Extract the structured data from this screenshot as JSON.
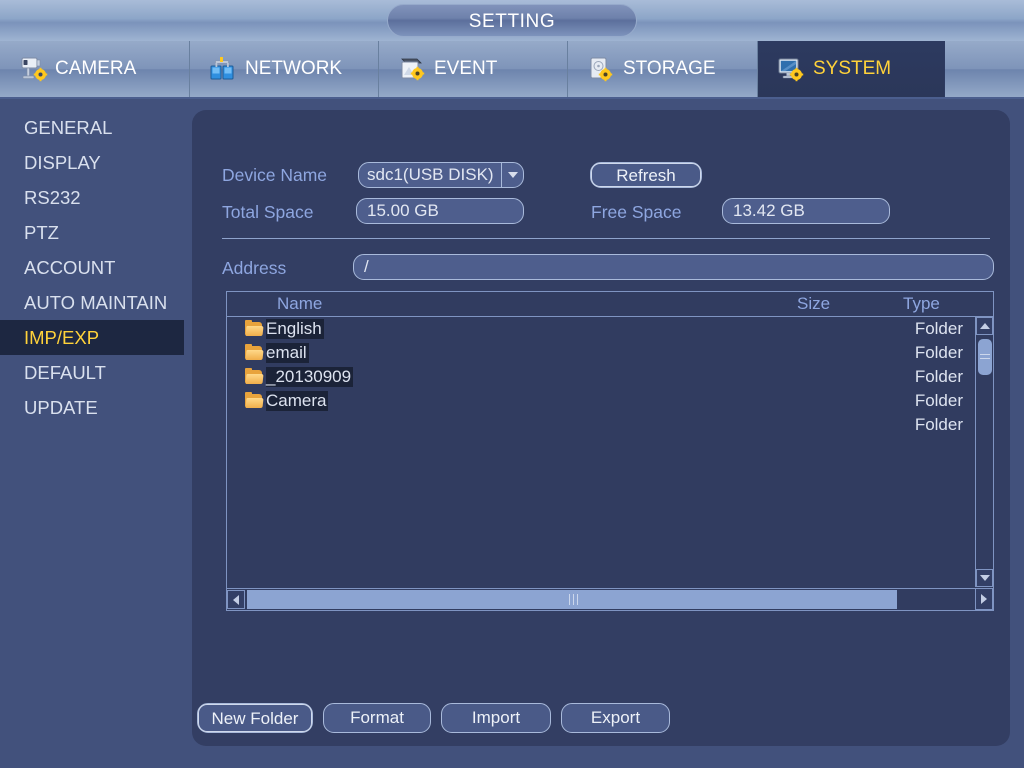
{
  "window": {
    "title": "SETTING"
  },
  "tabs": [
    {
      "label": "CAMERA",
      "icon": "camera-gear-icon",
      "active": false
    },
    {
      "label": "NETWORK",
      "icon": "network-icon",
      "active": false
    },
    {
      "label": "EVENT",
      "icon": "event-gear-icon",
      "active": false
    },
    {
      "label": "STORAGE",
      "icon": "storage-gear-icon",
      "active": false
    },
    {
      "label": "SYSTEM",
      "icon": "monitor-gear-icon",
      "active": true
    }
  ],
  "sidebar": {
    "items": [
      {
        "label": "GENERAL",
        "selected": false
      },
      {
        "label": "DISPLAY",
        "selected": false
      },
      {
        "label": "RS232",
        "selected": false
      },
      {
        "label": "PTZ",
        "selected": false
      },
      {
        "label": "ACCOUNT",
        "selected": false
      },
      {
        "label": "AUTO MAINTAIN",
        "selected": false
      },
      {
        "label": "IMP/EXP",
        "selected": true
      },
      {
        "label": "DEFAULT",
        "selected": false
      },
      {
        "label": "UPDATE",
        "selected": false
      }
    ]
  },
  "form": {
    "device_name_label": "Device Name",
    "device_name_value": "sdc1(USB DISK)",
    "refresh_label": "Refresh",
    "total_space_label": "Total Space",
    "total_space_value": "15.00 GB",
    "free_space_label": "Free Space",
    "free_space_value": "13.42 GB",
    "address_label": "Address",
    "address_value": "/"
  },
  "filelist": {
    "columns": {
      "name": "Name",
      "size": "Size",
      "type": "Type"
    },
    "rows": [
      {
        "name": "English",
        "size": "",
        "type": "Folder"
      },
      {
        "name": "email",
        "size": "",
        "type": "Folder"
      },
      {
        "name": "_20130909",
        "size": "",
        "type": "Folder"
      },
      {
        "name": "Camera",
        "size": "",
        "type": "Folder"
      },
      {
        "name": "",
        "size": "",
        "type": "Folder"
      }
    ]
  },
  "actions": {
    "new_folder": "New Folder",
    "format": "Format",
    "import": "Import",
    "export": "Export"
  },
  "colors": {
    "page_background": "#42517c",
    "panel_background": "#333e63",
    "accent_yellow": "#ffd23a",
    "label_blue": "#8ea6e0",
    "folder_orange": "#e8a33c"
  }
}
